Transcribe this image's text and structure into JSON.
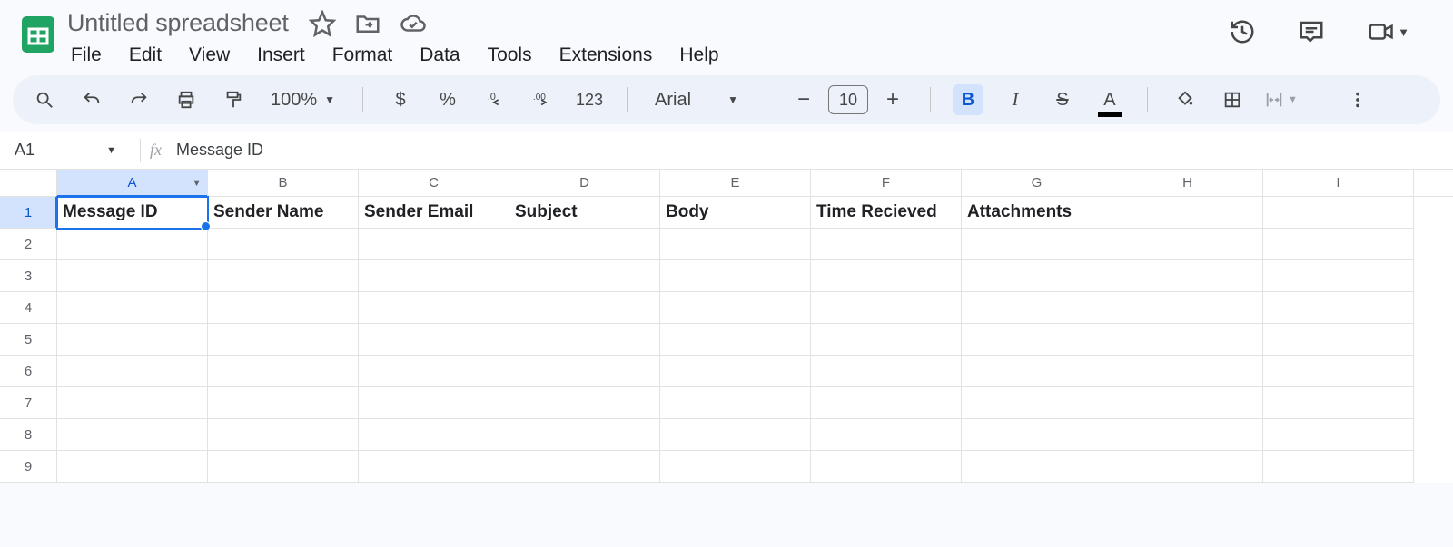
{
  "doc": {
    "title": "Untitled spreadsheet"
  },
  "menu": {
    "file": "File",
    "edit": "Edit",
    "view": "View",
    "insert": "Insert",
    "format": "Format",
    "data": "Data",
    "tools": "Tools",
    "extensions": "Extensions",
    "help": "Help"
  },
  "toolbar": {
    "zoom": "100%",
    "currency": "$",
    "percent": "%",
    "dec_dec": ".0",
    "inc_dec": ".00",
    "num_format": "123",
    "font": "Arial",
    "font_size": "10",
    "bold": "B",
    "italic": "I",
    "strike": "S",
    "text_color": "A"
  },
  "cell_ref": {
    "name": "A1",
    "formula": "Message ID"
  },
  "columns": [
    "A",
    "B",
    "C",
    "D",
    "E",
    "F",
    "G",
    "H",
    "I"
  ],
  "selected_column_index": 0,
  "rows_shown": [
    1,
    2,
    3,
    4,
    5,
    6,
    7,
    8,
    9
  ],
  "selected_row_index": 0,
  "grid": {
    "r1": {
      "A": "Message ID",
      "B": "Sender Name",
      "C": "Sender Email",
      "D": "Subject",
      "E": "Body",
      "F": "Time Recieved",
      "G": "Attachments",
      "H": "",
      "I": ""
    }
  }
}
